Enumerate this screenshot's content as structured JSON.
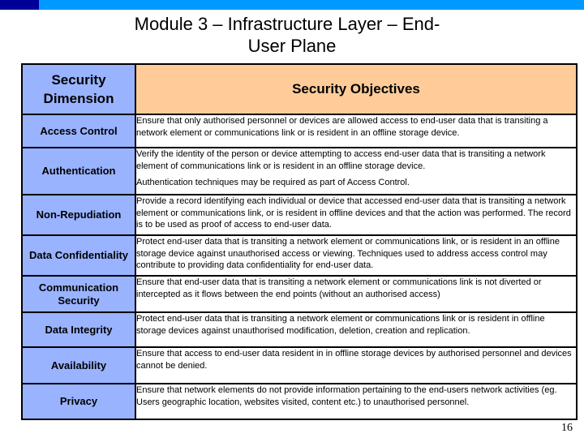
{
  "slide": {
    "title_line1": "Module 3 – Infrastructure Layer – End-",
    "title_line2": "User Plane",
    "page_number": "16"
  },
  "table": {
    "headers": {
      "dimension": "Security Dimension",
      "objectives": "Security Objectives"
    },
    "rows": [
      {
        "dimension": "Access Control",
        "objective": [
          "Ensure that only authorised personnel or devices are allowed access to end-user data that is transiting a network element or communications link or is resident in an offline storage device."
        ]
      },
      {
        "dimension": "Authentication",
        "objective": [
          "Verify the identity of the person or device attempting to access end-user data that is transiting a network element of communications link or is resident in an offline storage device.",
          "Authentication techniques may be required as part of Access Control."
        ]
      },
      {
        "dimension": "Non-Repudiation",
        "objective": [
          "Provide a record identifying each individual or device that accessed end-user data that is transiting a network element or communications link, or is resident in offline devices and that the action was performed. The record is to be used as proof of access to end-user data."
        ]
      },
      {
        "dimension": "Data Confidentiality",
        "objective": [
          "Protect end-user data that is transiting a network element or communications link, or is resident in an offline storage device against unauthorised access or viewing. Techniques used to address access control may contribute to providing data confidentiality for end-user data."
        ]
      },
      {
        "dimension": "Communication Security",
        "objective": [
          "Ensure that end-user data that is transiting a network element or communications link is not diverted or intercepted as it flows between the end points (without an authorised access)"
        ]
      },
      {
        "dimension": "Data Integrity",
        "objective": [
          "Protect end-user data that is transiting a network element or communications link or is resident in offline storage devices against unauthorised modification, deletion, creation and replication."
        ]
      },
      {
        "dimension": "Availability",
        "objective": [
          "Ensure that access to end-user data resident in in offline storage devices by authorised personnel and devices cannot be denied."
        ]
      },
      {
        "dimension": "Privacy",
        "objective": [
          "Ensure that network elements do not provide information pertaining to the end-users network activities (eg. Users geographic location, websites visited, content etc.) to unauthorised personnel."
        ]
      }
    ]
  },
  "colors": {
    "top_bar": "#0099ff",
    "top_bar_accent": "#000099",
    "dimension_fill": "#99b3ff",
    "objective_header_fill": "#ffcc99"
  }
}
